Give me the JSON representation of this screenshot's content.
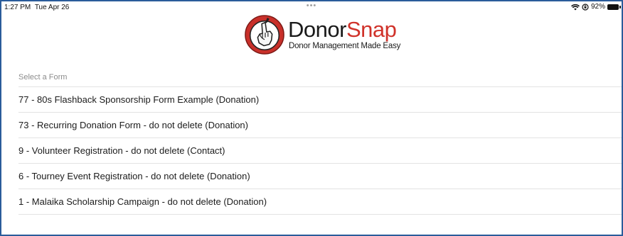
{
  "status_bar": {
    "time": "1:27 PM",
    "date": "Tue Apr 26",
    "dots": "•••",
    "wifi_icon": "wifi-icon",
    "orientation_icon": "orientation-lock-icon",
    "battery_text": "92%",
    "battery_level": 0.92
  },
  "header": {
    "logo_icon": "donorsnap-logo-icon",
    "logo_text_donor": "Donor",
    "logo_text_snap": "Snap",
    "tagline": "Donor Management Made Easy",
    "brand_red": "#d0322a"
  },
  "forms": {
    "section_label": "Select a Form",
    "items": [
      "77 - 80s Flashback Sponsorship Form Example (Donation)",
      "73 - Recurring Donation Form - do not delete (Donation)",
      "9 - Volunteer Registration - do not delete (Contact)",
      "6 - Tourney Event Registration - do not delete (Donation)",
      "1 - Malaika Scholarship Campaign - do not delete (Donation)"
    ]
  }
}
